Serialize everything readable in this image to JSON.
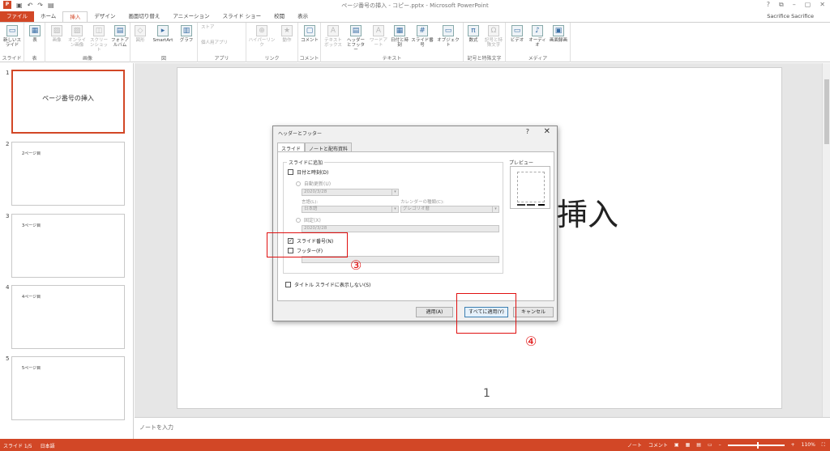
{
  "window": {
    "title": "ページ番号の挿入 - コピー.pptx - Microsoft PowerPoint",
    "user": "Sacrifice Sacrifice",
    "controls": [
      "?",
      "⧉",
      "–",
      "▢",
      "✕"
    ]
  },
  "tabs": [
    {
      "label": "ファイル"
    },
    {
      "label": "ホーム"
    },
    {
      "label": "挿入"
    },
    {
      "label": "デザイン"
    },
    {
      "label": "画面切り替え"
    },
    {
      "label": "アニメーション"
    },
    {
      "label": "スライド ショー"
    },
    {
      "label": "校閲"
    },
    {
      "label": "表示"
    }
  ],
  "ribbon": {
    "groups": {
      "slides": "スライド",
      "table": "表",
      "images": "画像",
      "illustrations": "図",
      "apps": "アプリ",
      "links": "リンク",
      "comments": "コメント",
      "text": "テキスト",
      "symbols": "記号と特殊文字",
      "media": "メディア"
    },
    "buttons": {
      "new_slide": "新しいスライド",
      "table": "表",
      "picture": "画像",
      "online_pictures": "オンライン画像",
      "screenshot": "スクリーンショット",
      "photo_album": "フォトアルバム",
      "shapes": "図形",
      "smartart": "SmartArt",
      "chart": "グラフ",
      "store": "ストア",
      "my_apps": "個人用アプリ",
      "hyperlink": "ハイパーリンク",
      "action": "動作",
      "comment": "コメント",
      "textbox": "テキストボックス",
      "header_footer": "ヘッダーとフッター",
      "wordart": "ワードアート",
      "date_time": "日付と時刻",
      "slide_number": "スライド番号",
      "object": "オブジェクト",
      "equation": "数式",
      "symbol": "記号と特殊文字",
      "video": "ビデオ",
      "audio": "オーディオ",
      "screen_recording": "画面録画"
    }
  },
  "thumbnails": [
    {
      "num": "1",
      "text": "ページ番号の挿入",
      "sub": "title"
    },
    {
      "num": "2",
      "text": "2ページ目"
    },
    {
      "num": "3",
      "text": "3ページ目"
    },
    {
      "num": "4",
      "text": "4ページ目"
    },
    {
      "num": "5",
      "text": "5ページ目"
    }
  ],
  "slide": {
    "visible_title": "挿入",
    "page_number": "1"
  },
  "notes_placeholder": "ノートを入力",
  "dialog": {
    "title": "ヘッダーとフッター",
    "help": "?",
    "close": "✕",
    "tab_slide": "スライド",
    "tab_notes": "ノートと配布資料",
    "include_label": "スライドに追加",
    "date_time": "日付と時刻(D)",
    "auto_update": "自動更新(U)",
    "date_value": "2020/3/28",
    "language_label": "言語(L):",
    "language_value": "日本語",
    "calendar_label": "カレンダーの種類(C):",
    "calendar_value": "グレゴリオ暦",
    "fixed": "固定(X)",
    "fixed_value": "2020/3/28",
    "slide_number": "スライド番号(N)",
    "slide_number_checked": true,
    "footer": "フッター(F)",
    "dont_show_title": "タイトル スライドに表示しない(S)",
    "preview_label": "プレビュー",
    "apply": "適用(A)",
    "apply_all": "すべてに適用(Y)",
    "cancel": "キャンセル"
  },
  "annotations": {
    "step3": "③",
    "step4": "④"
  },
  "status": {
    "slide": "スライド 1/5",
    "language": "日本語",
    "notes": "ノート",
    "comments": "コメント",
    "zoom": "110%"
  },
  "colors": {
    "accent": "#d24726",
    "annotation": "#e01010"
  }
}
